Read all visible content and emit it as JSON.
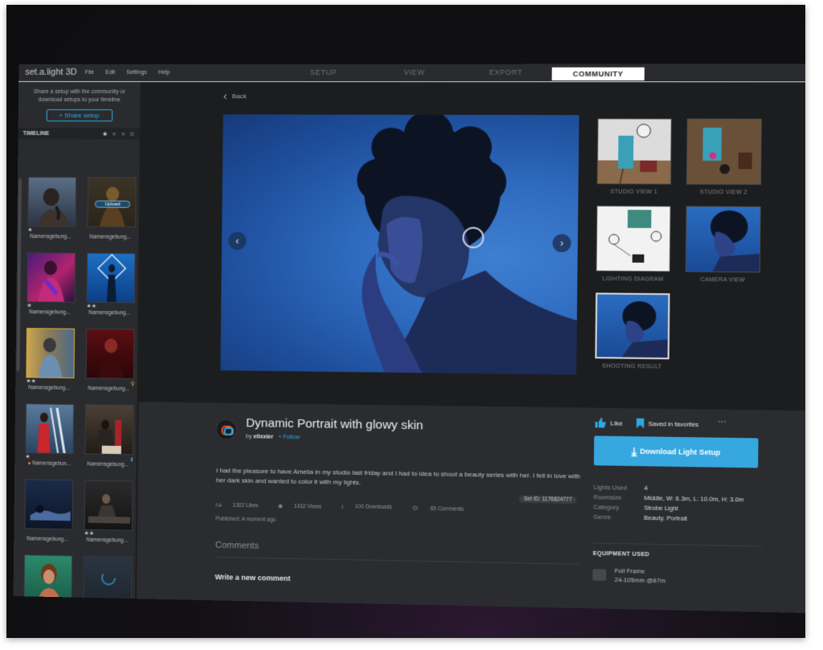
{
  "app": {
    "logo": "set.a.light 3D",
    "menu": [
      "File",
      "Edit",
      "Settings",
      "Help"
    ],
    "tabs": [
      "SETUP",
      "VIEW",
      "EXPORT",
      "COMMUNITY"
    ],
    "active_tab": "COMMUNITY"
  },
  "sidebar": {
    "share_text": "Share a setup with the community or download setups to your timeline",
    "share_button": "+ Share setup",
    "timeline_title": "TIMELINE",
    "items": [
      {
        "name": "Namensgebung...",
        "stars": "★",
        "thumb": "portrait-dark"
      },
      {
        "name": "Namensgebung...",
        "stars": "",
        "thumb": "upload",
        "tag": "Upload"
      },
      {
        "name": "Namensgebung...",
        "stars": "★",
        "thumb": "neon"
      },
      {
        "name": "Namensgebung...",
        "stars": "★★",
        "thumb": "blue-figure"
      },
      {
        "name": "Namensgebung...",
        "stars": "★★",
        "thumb": "yellow-selected"
      },
      {
        "name": "Namensgebung...",
        "stars": "",
        "thumb": "red"
      },
      {
        "name": "Namensgebun...",
        "stars": "★",
        "thumb": "ladder"
      },
      {
        "name": "Namensgebung...",
        "stars": "",
        "thumb": "studio"
      },
      {
        "name": "Namensgebung...",
        "stars": "",
        "thumb": "reclining"
      },
      {
        "name": "Namensgebung...",
        "stars": "★★",
        "thumb": "sitting"
      },
      {
        "name": "",
        "stars": "★★",
        "thumb": "green"
      },
      {
        "name": "",
        "stars": "",
        "thumb": "loading"
      }
    ]
  },
  "main": {
    "back": "Back",
    "views": [
      {
        "label": "STUDIO VIEW 1"
      },
      {
        "label": "STUDIO VIEW 2"
      },
      {
        "label": "LIGHTING DIAGRAM"
      },
      {
        "label": "CAMERA VIEW"
      },
      {
        "label": "SHOOTING RESULT"
      }
    ]
  },
  "setup": {
    "title": "Dynamic Portrait with glowy skin",
    "by": "by",
    "author": "elixxier",
    "follow": "+ Follow",
    "description": "I had the pleasure to have Amelia in my studio last friday and I had to idea to shoot a beauty series with her. I fell in love with her dark skin and wanted to color it with my lights.",
    "set_id": "Set ID: 1176824777",
    "stats": {
      "likes": "1302 Likes",
      "views": "1432 Views",
      "downloads": "100 Downloads",
      "comments": "65 Comments"
    },
    "published": "Published: A moment ago",
    "comments_heading": "Comments",
    "write_comment": "Write a new comment"
  },
  "actions": {
    "like": "Like",
    "saved": "Saved in favorites",
    "more": "···",
    "download": "Download Light Setup"
  },
  "specs": [
    {
      "key": "Lights Used",
      "value": "4"
    },
    {
      "key": "Roomsize",
      "value": "Middle, W: 6.3m, L: 10.0m, H: 3.0m"
    },
    {
      "key": "Category",
      "value": "Strobe Light"
    },
    {
      "key": "Genre",
      "value": "Beauty, Portrait"
    }
  ],
  "equipment": {
    "heading": "EQUIPMENT USED",
    "item_name": "Full Frame",
    "item_lens": "24-105mm @87m"
  },
  "colors": {
    "accent": "#2da8e0",
    "download_button": "#36a7df",
    "selected_border": "#d8a93a"
  }
}
